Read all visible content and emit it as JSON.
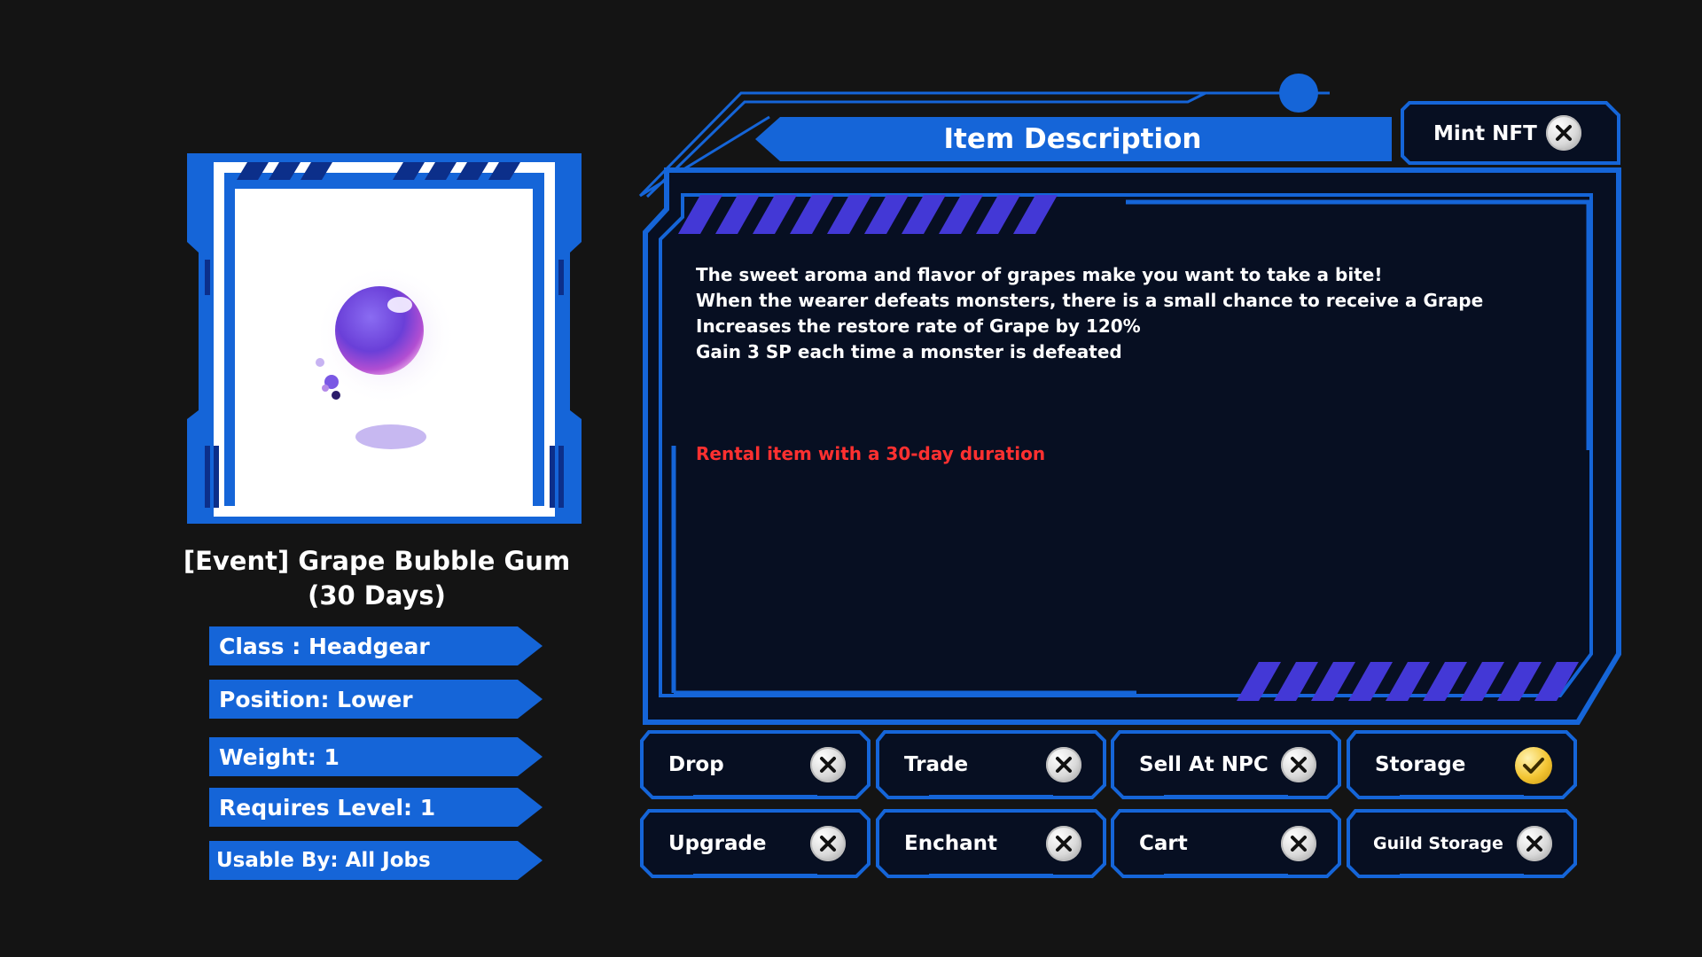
{
  "item": {
    "name_line1": "[Event] Grape Bubble Gum",
    "name_line2": "(30 Days)",
    "image_icon": "grape-bubble-gum-icon",
    "stats": [
      {
        "label": "Class : Headgear"
      },
      {
        "label": "Position: Lower"
      },
      {
        "label": "Weight: 1"
      },
      {
        "label": "Requires Level: 1"
      },
      {
        "label": "Usable By: All Jobs"
      }
    ]
  },
  "panel": {
    "title": "Item Description",
    "mint": {
      "label": "Mint NFT",
      "state": "disabled",
      "icon": "x-icon"
    },
    "description": [
      "The sweet aroma and flavor of grapes make you want to take a bite!",
      "When the wearer defeats monsters, there is a small chance to receive a Grape",
      "Increases the restore rate of Grape by 120%",
      "Gain 3 SP each time a monster is defeated"
    ],
    "rental_note": "Rental item with a 30-day duration"
  },
  "permissions": [
    {
      "label": "Drop",
      "allowed": false,
      "icon": "x-icon"
    },
    {
      "label": "Trade",
      "allowed": false,
      "icon": "x-icon"
    },
    {
      "label": "Sell At NPC",
      "allowed": false,
      "icon": "x-icon"
    },
    {
      "label": "Storage",
      "allowed": true,
      "icon": "check-icon"
    },
    {
      "label": "Upgrade",
      "allowed": false,
      "icon": "x-icon"
    },
    {
      "label": "Enchant",
      "allowed": false,
      "icon": "x-icon"
    },
    {
      "label": "Cart",
      "allowed": false,
      "icon": "x-icon"
    },
    {
      "label": "Guild Storage",
      "allowed": false,
      "icon": "x-icon"
    }
  ],
  "colors": {
    "background": "#141414",
    "accent_blue": "#1565d8",
    "panel_fill": "#070f22",
    "stripe_purple": "#4338d6",
    "rental_red": "#ff3030",
    "check_gold": "#f3c533"
  }
}
